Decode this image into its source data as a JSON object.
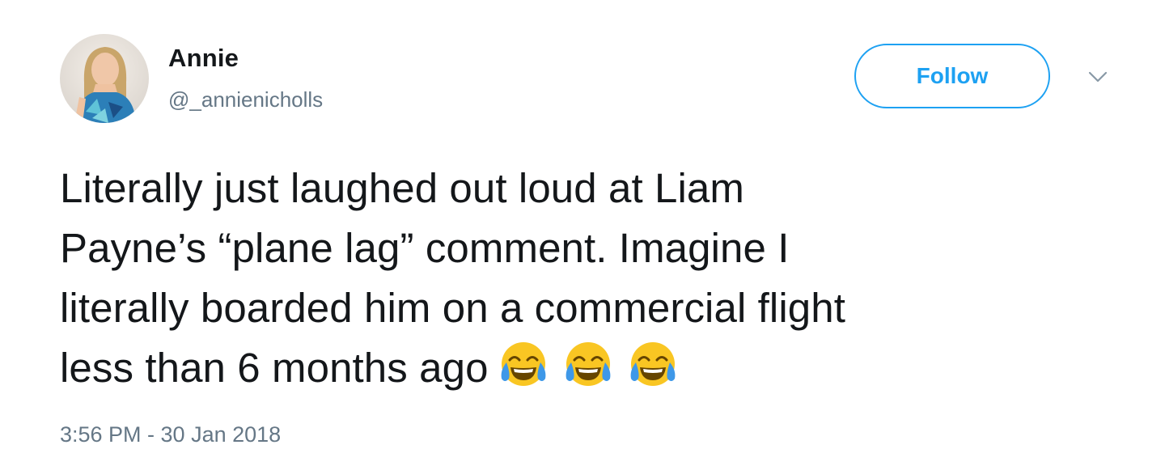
{
  "user": {
    "display_name": "Annie",
    "handle": "@_annienicholls"
  },
  "follow_button": {
    "label": "Follow"
  },
  "menu": {
    "icon": "chevron-down-icon"
  },
  "tweet": {
    "lines": [
      "Literally just laughed out loud at Liam",
      "Payne’s “plane lag” comment. Imagine I",
      "literally boarded him on a commercial flight",
      "less than 6 months ago"
    ],
    "emojis": [
      "face-with-tears-of-joy",
      "face-with-tears-of-joy",
      "face-with-tears-of-joy"
    ]
  },
  "timestamp": "3:56 PM - 30 Jan 2018",
  "colors": {
    "accent": "#1da1f2",
    "text": "#14171a",
    "secondary_text": "#657786",
    "emoji_face": "#f9c623",
    "emoji_tears": "#3e98e8"
  }
}
